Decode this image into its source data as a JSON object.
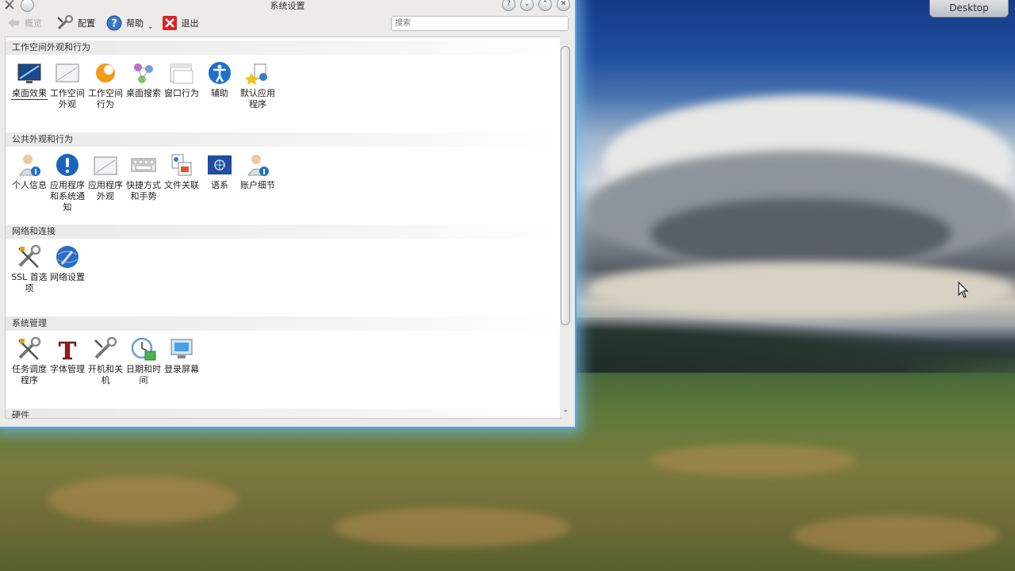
{
  "desktop": {
    "label": "Desktop"
  },
  "window": {
    "title": "系统设置",
    "toolbar": {
      "back": "概览",
      "configure": "配置",
      "help": "帮助",
      "quit": "退出",
      "search_placeholder": "搜索"
    }
  },
  "groups": [
    {
      "title": "工作空间外观和行为",
      "items": [
        {
          "label": "桌面效果",
          "icon": "desktop-effects-icon"
        },
        {
          "label": "工作空间外观",
          "icon": "workspace-appearance-icon"
        },
        {
          "label": "工作空间行为",
          "icon": "workspace-behavior-icon"
        },
        {
          "label": "桌面搜索",
          "icon": "desktop-search-icon"
        },
        {
          "label": "窗口行为",
          "icon": "window-behavior-icon"
        },
        {
          "label": "辅助",
          "icon": "accessibility-icon"
        },
        {
          "label": "默认应用程序",
          "icon": "default-applications-icon"
        }
      ]
    },
    {
      "title": "公共外观和行为",
      "items": [
        {
          "label": "个人信息",
          "icon": "personal-info-icon"
        },
        {
          "label": "应用程序和系统通知",
          "icon": "notifications-icon"
        },
        {
          "label": "应用程序外观",
          "icon": "application-appearance-icon"
        },
        {
          "label": "快捷方式和手势",
          "icon": "shortcuts-icon"
        },
        {
          "label": "文件关联",
          "icon": "file-associations-icon"
        },
        {
          "label": "语系",
          "icon": "locale-icon"
        },
        {
          "label": "账户细节",
          "icon": "account-details-icon"
        }
      ]
    },
    {
      "title": "网络和连接",
      "items": [
        {
          "label": "SSL 首选项",
          "icon": "ssl-preferences-icon"
        },
        {
          "label": "网络设置",
          "icon": "network-settings-icon"
        }
      ]
    },
    {
      "title": "系统管理",
      "items": [
        {
          "label": "任务调度程序",
          "icon": "task-scheduler-icon"
        },
        {
          "label": "字体管理",
          "icon": "font-management-icon"
        },
        {
          "label": "开机和关机",
          "icon": "startup-shutdown-icon"
        },
        {
          "label": "日期和时间",
          "icon": "date-time-icon"
        },
        {
          "label": "登录屏幕",
          "icon": "login-screen-icon"
        }
      ]
    },
    {
      "title": "硬件",
      "items": []
    }
  ]
}
